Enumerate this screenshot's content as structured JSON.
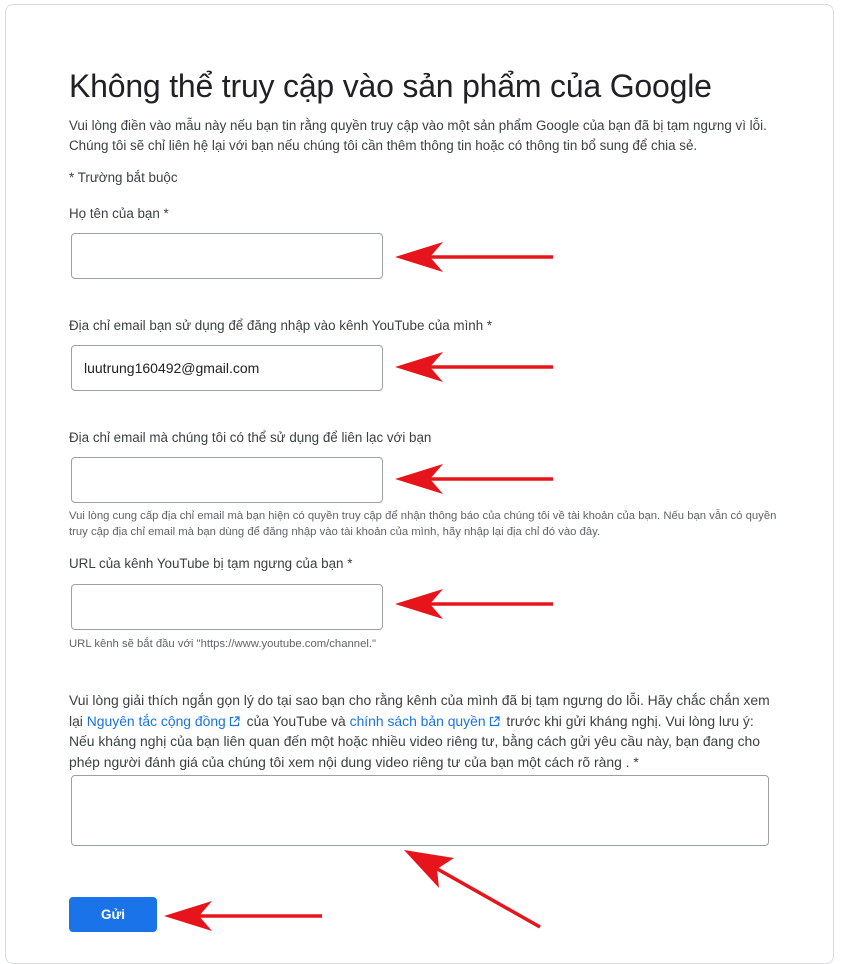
{
  "page": {
    "title": "Không thể truy cập vào sản phẩm của Google",
    "intro": "Vui lòng điền vào mẫu này nếu bạn tin rằng quyền truy cập vào một sản phẩm Google của bạn đã bị tạm ngưng vì lỗi. Chúng tôi sẽ chỉ liên hệ lại với bạn nếu chúng tôi cần thêm thông tin hoặc có thông tin bổ sung để chia sẻ.",
    "required_note": "* Trường bắt buộc"
  },
  "fields": {
    "name": {
      "label": "Họ tên của bạn *",
      "value": ""
    },
    "login_email": {
      "label": "Địa chỉ email bạn sử dụng để đăng nhập vào kênh YouTube của mình *",
      "value": "luutrung160492@gmail.com"
    },
    "contact_email": {
      "label": "Địa chỉ email mà chúng tôi có thể sử dụng để liên lạc với bạn",
      "value": "",
      "help": "Vui lòng cung cấp địa chỉ email mà bạn hiện có quyền truy cập để nhận thông báo của chúng tôi về tài khoản của bạn. Nếu bạn vẫn có quyền truy cập địa chỉ email mà bạn dùng để đăng nhập vào tài khoản của mình, hãy nhập lại địa chỉ đó vào đây."
    },
    "channel_url": {
      "label": "URL của kênh YouTube bị tạm ngưng của bạn *",
      "value": "",
      "help": "URL kênh sẽ bắt đầu với \"https://www.youtube.com/channel.\""
    },
    "explanation": {
      "part1": "Vui lòng giải thích ngắn gọn lý do tại sao bạn cho rằng kênh của mình đã bị tạm ngưng do lỗi. Hãy chắc chắn xem lại",
      "link1": "Nguyên tắc cộng đồng",
      "part2": "của YouTube và",
      "link2": "chính sách bản quyền",
      "part3": "trước khi gửi kháng nghị. Vui lòng lưu ý: Nếu kháng nghị của bạn liên quan đến một hoặc nhiều video riêng tư, bằng cách gửi yêu cầu này, bạn đang cho phép người đánh giá của chúng tôi xem nội dung video riêng tư của bạn một cách rõ ràng . *",
      "value": ""
    }
  },
  "submit": {
    "label": "Gửi"
  },
  "colors": {
    "accent": "#1a73e8",
    "annotation_arrow": "#e8141c",
    "border": "#9aa0a6"
  },
  "icons": {
    "external_link": "external-link-icon",
    "annotation": "red-arrow"
  }
}
